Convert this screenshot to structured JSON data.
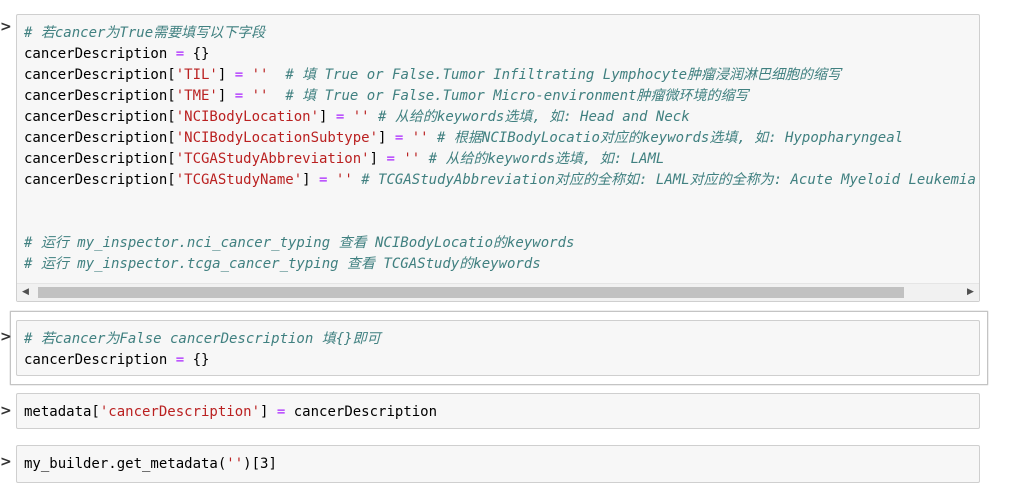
{
  "cells": [
    {
      "prompt": ">",
      "lines": [
        [
          {
            "t": "# 若cancer为True需要填写以下字段",
            "c": "cm"
          }
        ],
        [
          {
            "t": "cancerDescription "
          },
          {
            "t": "=",
            "c": "op"
          },
          {
            "t": " {}"
          }
        ],
        [
          {
            "t": "cancerDescription["
          },
          {
            "t": "'TIL'",
            "c": "str"
          },
          {
            "t": "] "
          },
          {
            "t": "=",
            "c": "op"
          },
          {
            "t": " "
          },
          {
            "t": "''",
            "c": "str"
          },
          {
            "t": "  "
          },
          {
            "t": "# 填 True or False.Tumor Infiltrating Lymphocyte肿瘤浸润淋巴细胞的缩写",
            "c": "cm"
          }
        ],
        [
          {
            "t": "cancerDescription["
          },
          {
            "t": "'TME'",
            "c": "str"
          },
          {
            "t": "] "
          },
          {
            "t": "=",
            "c": "op"
          },
          {
            "t": " "
          },
          {
            "t": "''",
            "c": "str"
          },
          {
            "t": "  "
          },
          {
            "t": "# 填 True or False.Tumor Micro-environment肿瘤微环境的缩写",
            "c": "cm"
          }
        ],
        [
          {
            "t": "cancerDescription["
          },
          {
            "t": "'NCIBodyLocation'",
            "c": "str"
          },
          {
            "t": "] "
          },
          {
            "t": "=",
            "c": "op"
          },
          {
            "t": " "
          },
          {
            "t": "''",
            "c": "str"
          },
          {
            "t": " "
          },
          {
            "t": "# 从给的keywords选填, 如: Head and Neck",
            "c": "cm"
          }
        ],
        [
          {
            "t": "cancerDescription["
          },
          {
            "t": "'NCIBodyLocationSubtype'",
            "c": "str"
          },
          {
            "t": "] "
          },
          {
            "t": "=",
            "c": "op"
          },
          {
            "t": " "
          },
          {
            "t": "''",
            "c": "str"
          },
          {
            "t": " "
          },
          {
            "t": "# 根据NCIBodyLocatio对应的keywords选填, 如: Hypopharyngeal",
            "c": "cm"
          }
        ],
        [
          {
            "t": "cancerDescription["
          },
          {
            "t": "'TCGAStudyAbbreviation'",
            "c": "str"
          },
          {
            "t": "] "
          },
          {
            "t": "=",
            "c": "op"
          },
          {
            "t": " "
          },
          {
            "t": "''",
            "c": "str"
          },
          {
            "t": " "
          },
          {
            "t": "# 从给的keywords选填, 如: LAML",
            "c": "cm"
          }
        ],
        [
          {
            "t": "cancerDescription["
          },
          {
            "t": "'TCGAStudyName'",
            "c": "str"
          },
          {
            "t": "] "
          },
          {
            "t": "=",
            "c": "op"
          },
          {
            "t": " "
          },
          {
            "t": "''",
            "c": "str"
          },
          {
            "t": " "
          },
          {
            "t": "# TCGAStudyAbbreviation对应的全称如: LAML对应的全称为: Acute Myeloid Leukemia",
            "c": "cm"
          }
        ],
        [],
        [],
        [
          {
            "t": "# 运行 my_inspector.nci_cancer_typing 查看 NCIBodyLocatio的keywords",
            "c": "cm"
          }
        ],
        [
          {
            "t": "# 运行 my_inspector.tcga_cancer_typing 查看 TCGAStudy的keywords",
            "c": "cm"
          }
        ]
      ],
      "scroll_left_arrow": "◀",
      "scroll_right_arrow": "▶",
      "horizontal_scroll_fraction": 0.0
    },
    {
      "prompt": ">",
      "lines": [
        [
          {
            "t": "# 若cancer为False cancerDescription 填{}即可",
            "c": "cm"
          }
        ],
        [
          {
            "t": "cancerDescription "
          },
          {
            "t": "=",
            "c": "op"
          },
          {
            "t": " {}"
          }
        ]
      ]
    },
    {
      "prompt": ">",
      "lines": [
        [
          {
            "t": "metadata["
          },
          {
            "t": "'cancerDescription'",
            "c": "str"
          },
          {
            "t": "] "
          },
          {
            "t": "=",
            "c": "op"
          },
          {
            "t": " cancerDescription"
          }
        ]
      ]
    },
    {
      "prompt": ">",
      "lines": [
        [
          {
            "t": "my_builder.get_metadata("
          },
          {
            "t": "''",
            "c": "str"
          },
          {
            "t": ")[3]"
          }
        ]
      ]
    }
  ],
  "colors": {
    "comment": "#408080",
    "string": "#ba2121",
    "operator": "#aa22ff",
    "input_background": "#f7f7f7"
  }
}
